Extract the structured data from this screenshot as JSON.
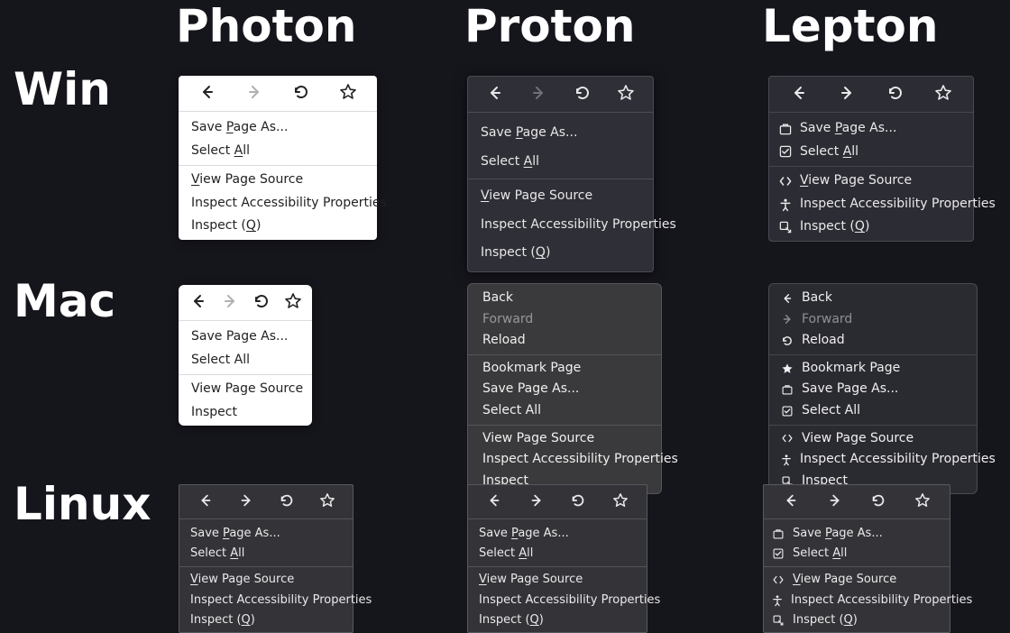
{
  "columns": {
    "photon": "Photon",
    "proton": "Proton",
    "lepton": "Lepton"
  },
  "rows": {
    "win": "Win",
    "mac": "Mac",
    "linux": "Linux"
  },
  "toolbar": {
    "back_label": "Back",
    "forward_label": "Forward",
    "reload_label": "Reload",
    "bookmark_label": "Bookmark"
  },
  "items": {
    "save_page_as": {
      "pre": "Save ",
      "u": "P",
      "post": "age As..."
    },
    "save_page_as_plain": "Save Page As...",
    "select_all": {
      "pre": "Select ",
      "u": "A",
      "post": "ll"
    },
    "select_all_plain": "Select All",
    "view_page_source": {
      "pre": "",
      "u": "V",
      "post": "iew Page Source"
    },
    "view_page_source_plain": "View Page Source",
    "inspect_a11y": "Inspect Accessibility Properties",
    "inspect_q": {
      "pre": "Inspect (",
      "u": "Q",
      "post": ")"
    },
    "inspect_plain": "Inspect",
    "bookmark_page": "Bookmark Page",
    "back": "Back",
    "forward": "Forward",
    "reload": "Reload"
  }
}
